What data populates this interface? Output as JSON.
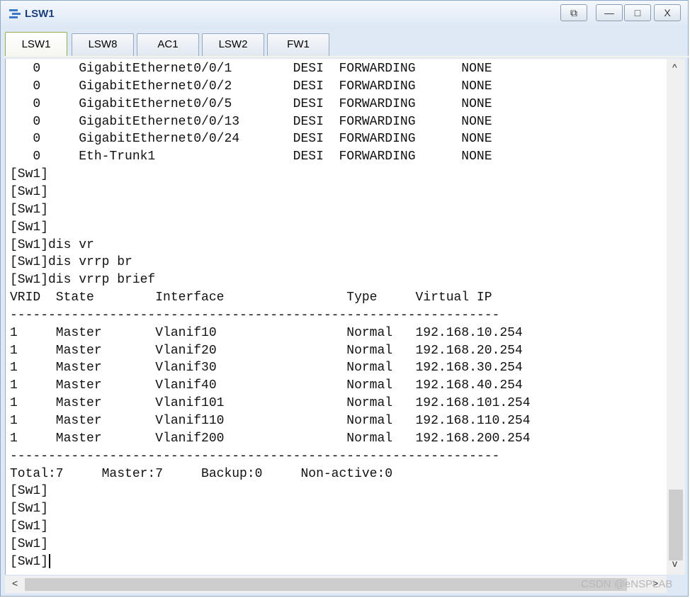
{
  "window": {
    "title": "LSW1"
  },
  "controls": {
    "restore": "⧉",
    "minimize": "—",
    "maximize": "□",
    "close": "X"
  },
  "tabs": [
    "LSW1",
    "LSW8",
    "AC1",
    "LSW2",
    "FW1"
  ],
  "terminal": {
    "lines": [
      "   0     GigabitEthernet0/0/1        DESI  FORWARDING      NONE",
      "   0     GigabitEthernet0/0/2        DESI  FORWARDING      NONE",
      "   0     GigabitEthernet0/0/5        DESI  FORWARDING      NONE",
      "   0     GigabitEthernet0/0/13       DESI  FORWARDING      NONE",
      "   0     GigabitEthernet0/0/24       DESI  FORWARDING      NONE",
      "   0     Eth-Trunk1                  DESI  FORWARDING      NONE",
      "[Sw1]",
      "[Sw1]",
      "[Sw1]",
      "[Sw1]",
      "[Sw1]dis vr",
      "[Sw1]dis vrrp br",
      "[Sw1]dis vrrp brief",
      "VRID  State        Interface                Type     Virtual IP",
      "----------------------------------------------------------------",
      "1     Master       Vlanif10                 Normal   192.168.10.254",
      "1     Master       Vlanif20                 Normal   192.168.20.254",
      "1     Master       Vlanif30                 Normal   192.168.30.254",
      "1     Master       Vlanif40                 Normal   192.168.40.254",
      "1     Master       Vlanif101                Normal   192.168.101.254",
      "1     Master       Vlanif110                Normal   192.168.110.254",
      "1     Master       Vlanif200                Normal   192.168.200.254",
      "----------------------------------------------------------------",
      "Total:7     Master:7     Backup:0     Non-active:0",
      "[Sw1]",
      "[Sw1]",
      "[Sw1]",
      "[Sw1]",
      "[Sw1]"
    ]
  },
  "scrollbar": {
    "up": "^",
    "down": "v",
    "left": "<",
    "right": ">"
  },
  "watermark": "CSDN @eNSPLAB"
}
